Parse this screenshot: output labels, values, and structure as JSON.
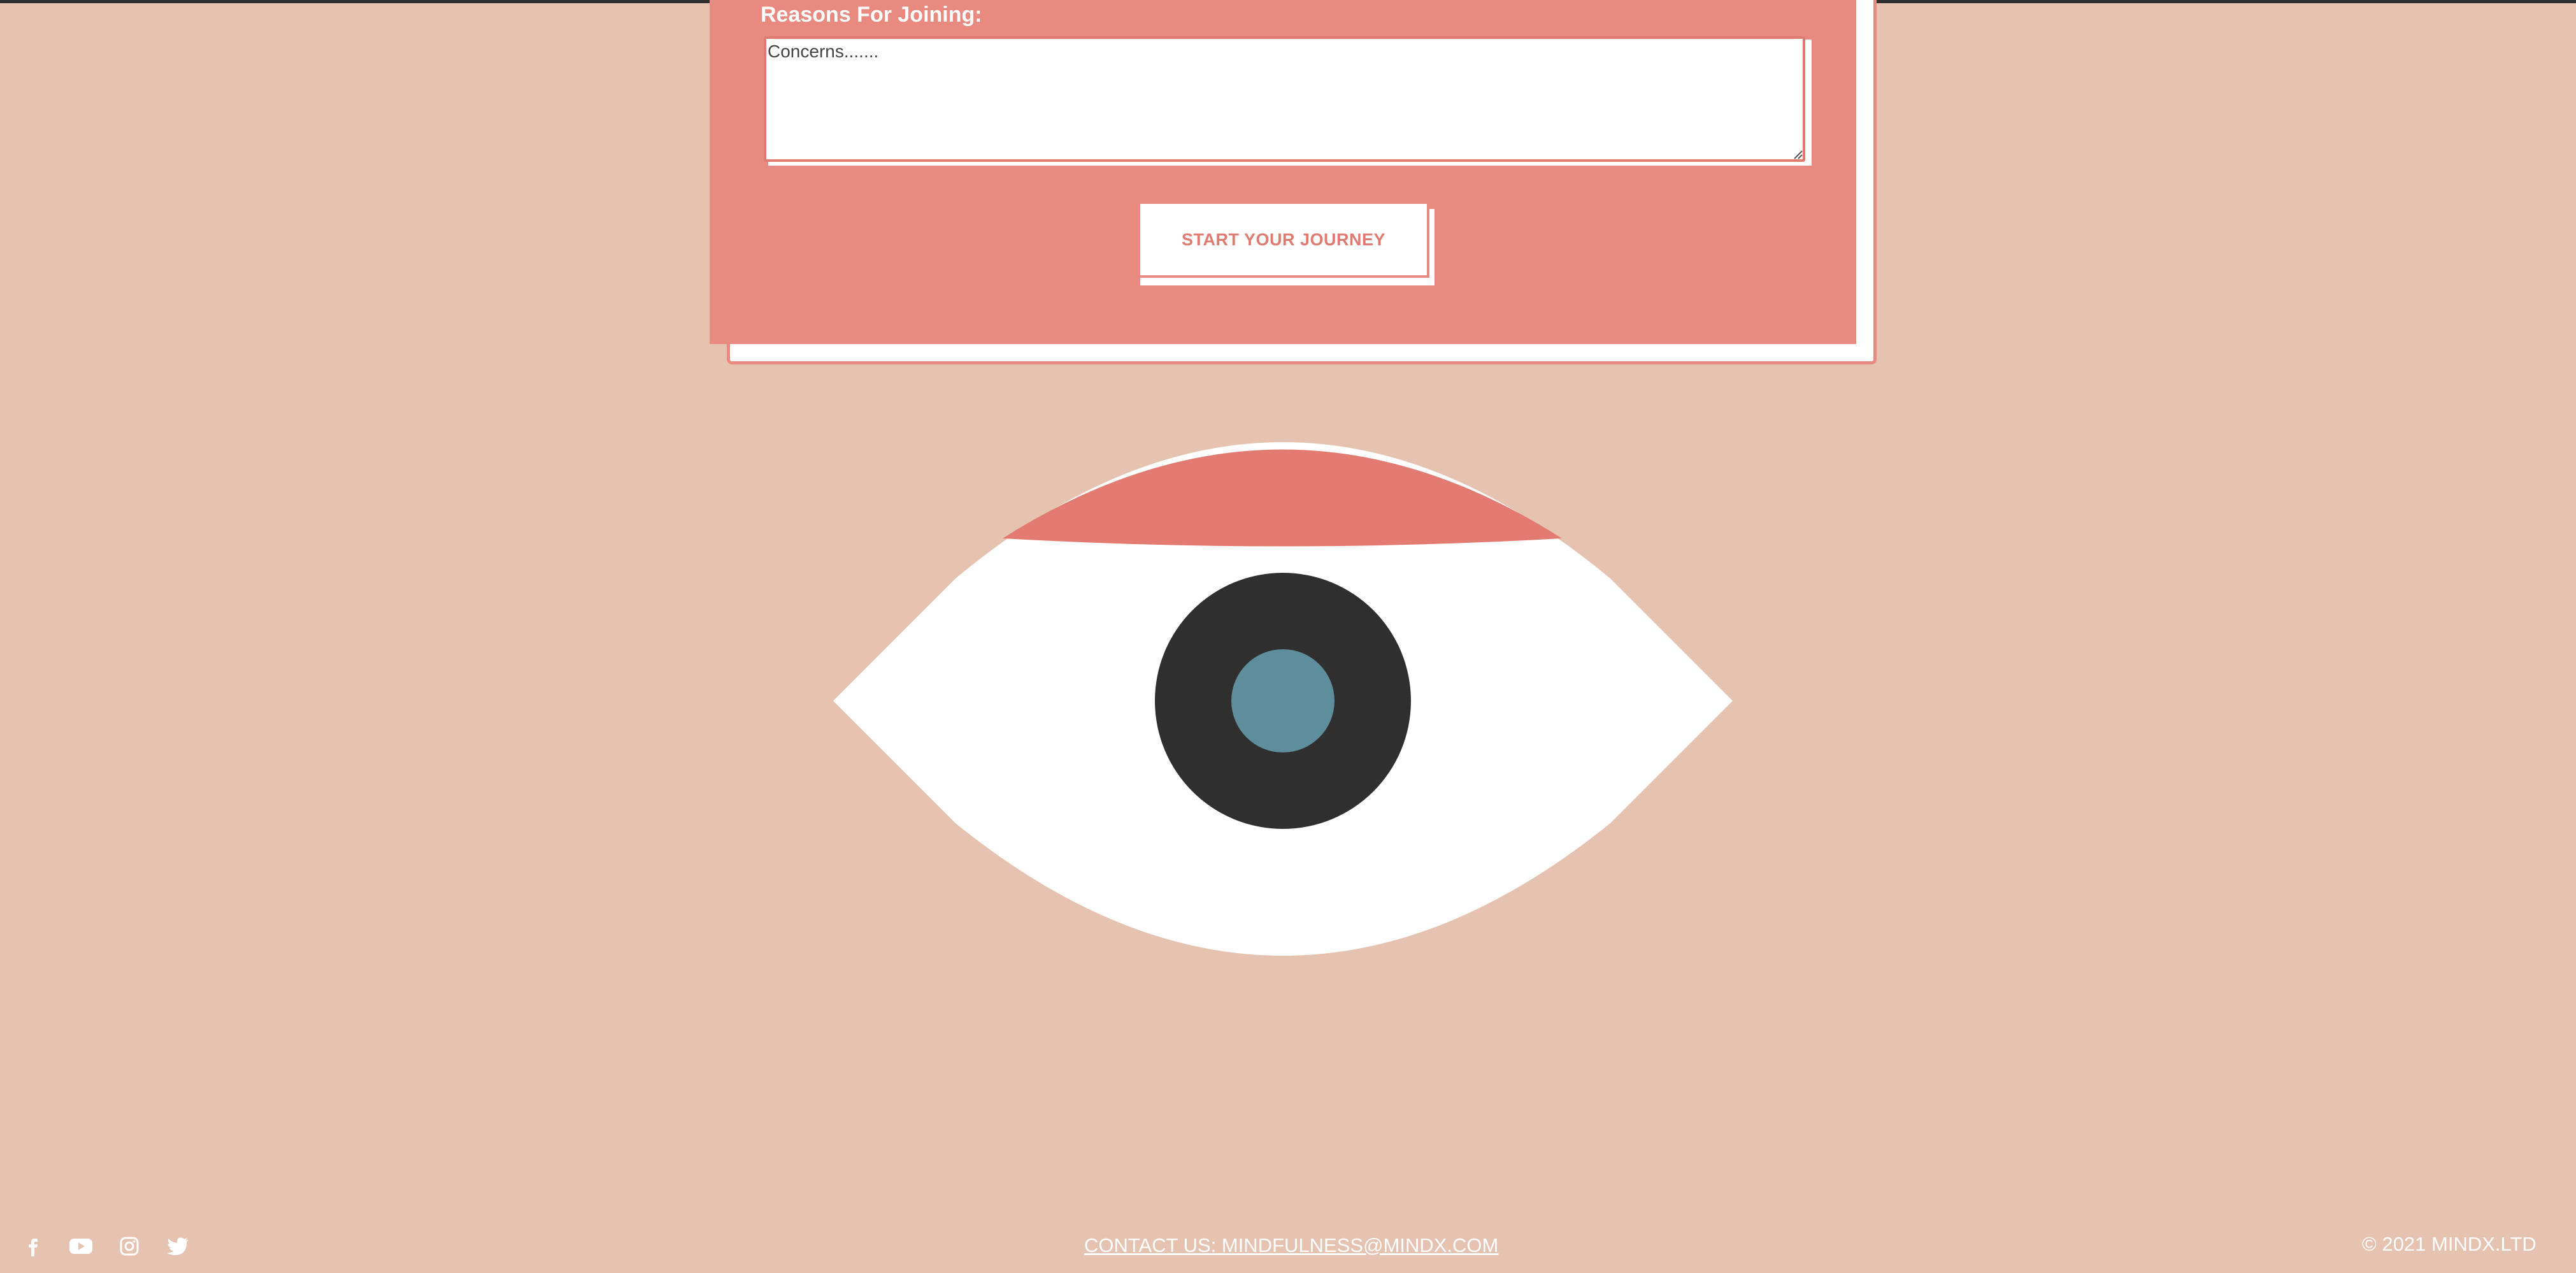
{
  "form": {
    "reasons_label": "Reasons For Joining:",
    "reasons_placeholder": "Concerns.......",
    "submit_label": "START YOUR JOURNEY"
  },
  "illustration": {
    "name": "eye"
  },
  "footer": {
    "social_icons": [
      "facebook-icon",
      "youtube-icon",
      "instagram-icon",
      "twitter-icon"
    ],
    "contact_text": "CONTACT US: MINDFULNESS@MINDX.COM",
    "copyright_text": "© 2021 MINDX.LTD"
  },
  "colors": {
    "page_background": "#e6c3b0",
    "card_coral": "#e88a80",
    "eyelid": "#e47b72",
    "iris": "#2f2f2f",
    "pupil": "#5e8d9b",
    "white": "#ffffff"
  }
}
